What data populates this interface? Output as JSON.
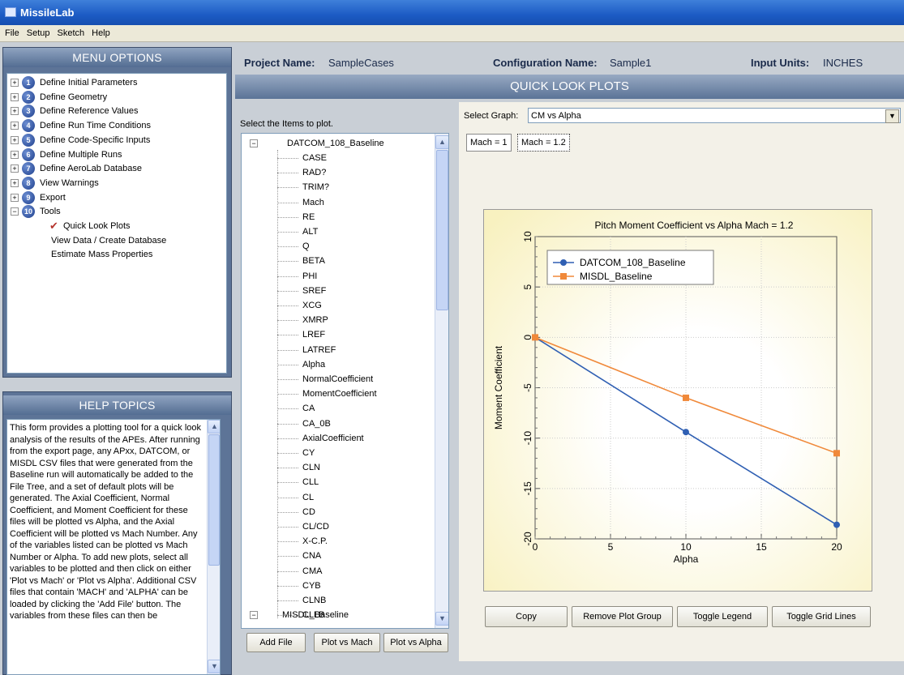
{
  "window": {
    "title": "MissileLab"
  },
  "menubar": [
    "File",
    "Setup",
    "Sketch",
    "Help"
  ],
  "menu_options": {
    "title": "MENU OPTIONS",
    "items": [
      {
        "num": "1",
        "label": "Define Initial Parameters"
      },
      {
        "num": "2",
        "label": "Define Geometry"
      },
      {
        "num": "3",
        "label": "Define Reference Values"
      },
      {
        "num": "4",
        "label": "Define Run Time Conditions"
      },
      {
        "num": "5",
        "label": "Define Code-Specific Inputs"
      },
      {
        "num": "6",
        "label": "Define Multiple Runs"
      },
      {
        "num": "7",
        "label": "Define AeroLab Database"
      },
      {
        "num": "8",
        "label": "View Warnings"
      },
      {
        "num": "9",
        "label": "Export"
      },
      {
        "num": "10",
        "label": "Tools"
      }
    ],
    "tools_children": [
      "Quick Look Plots",
      "View Data / Create Database",
      "Estimate Mass Properties"
    ]
  },
  "help": {
    "title": "HELP TOPICS",
    "text": "This form provides a plotting tool for a quick look analysis of the results of the APEs.  After running from the export page, any APxx, DATCOM, or MISDL CSV files that were generated from the Baseline run will automatically be added to the File Tree, and a set of default plots will be generated.  The Axial Coefficient, Normal Coefficient, and Moment Coefficient for these files will be plotted vs Alpha, and the Axial Coefficient will be plotted vs Mach Number.  Any of the variables listed can be plotted vs Mach Number or Alpha.  To add new plots, select all variables to be plotted and then click on either 'Plot vs Mach' or 'Plot vs Alpha'.  Additional CSV files that contain 'MACH' and 'ALPHA' can be loaded by clicking the 'Add File' button.  The variables from these files can then be"
  },
  "header": {
    "project_label": "Project Name:",
    "project_value": "SampleCases",
    "config_label": "Configuration Name:",
    "config_value": "Sample1",
    "units_label": "Input Units:",
    "units_value": "INCHES",
    "section_title": "QUICK LOOK PLOTS"
  },
  "items": {
    "label": "Select the Items to plot.",
    "file1": "DATCOM_108_Baseline",
    "variables": [
      "CASE",
      "RAD?",
      "TRIM?",
      "Mach",
      "RE",
      "ALT",
      "Q",
      "BETA",
      "PHI",
      "SREF",
      "XCG",
      "XMRP",
      "LREF",
      "LATREF",
      "Alpha",
      "NormalCoefficient",
      "MomentCoefficient",
      "CA",
      "CA_0B",
      "AxialCoefficient",
      "CY",
      "CLN",
      "CLL",
      "CL",
      "CD",
      "CL/CD",
      "X-C.P.",
      "CNA",
      "CMA",
      "CYB",
      "CLNB",
      "CLLB"
    ],
    "file2": "MISDL_Baseline",
    "buttons": {
      "add_file": "Add File",
      "plot_mach": "Plot vs Mach",
      "plot_alpha": "Plot vs Alpha"
    }
  },
  "graph": {
    "select_label": "Select Graph:",
    "selected": "CM vs Alpha",
    "tabs": [
      "Mach = 1",
      "Mach = 1.2"
    ],
    "active_tab": 1,
    "buttons": {
      "copy": "Copy",
      "remove": "Remove Plot Group",
      "legend": "Toggle Legend",
      "grid": "Toggle Grid Lines"
    }
  },
  "chart_data": {
    "type": "line",
    "title": "Pitch Moment Coefficient vs Alpha    Mach = 1.2",
    "xlabel": "Alpha",
    "ylabel": "Moment Coefficient",
    "xlim": [
      0,
      20
    ],
    "ylim": [
      -20,
      10
    ],
    "xticks": [
      0,
      5,
      10,
      15,
      20
    ],
    "yticks": [
      -20,
      -15,
      -10,
      -5,
      0,
      5,
      10
    ],
    "legend_position": "top-left",
    "grid": true,
    "series": [
      {
        "name": "DATCOM_108_Baseline",
        "color": "#2f5fb3",
        "marker": "circle",
        "x": [
          0,
          10,
          20
        ],
        "y": [
          0,
          -9.4,
          -18.6
        ]
      },
      {
        "name": "MISDL_Baseline",
        "color": "#f0893a",
        "marker": "square",
        "x": [
          0,
          10,
          20
        ],
        "y": [
          0,
          -6,
          -11.5
        ]
      }
    ]
  }
}
